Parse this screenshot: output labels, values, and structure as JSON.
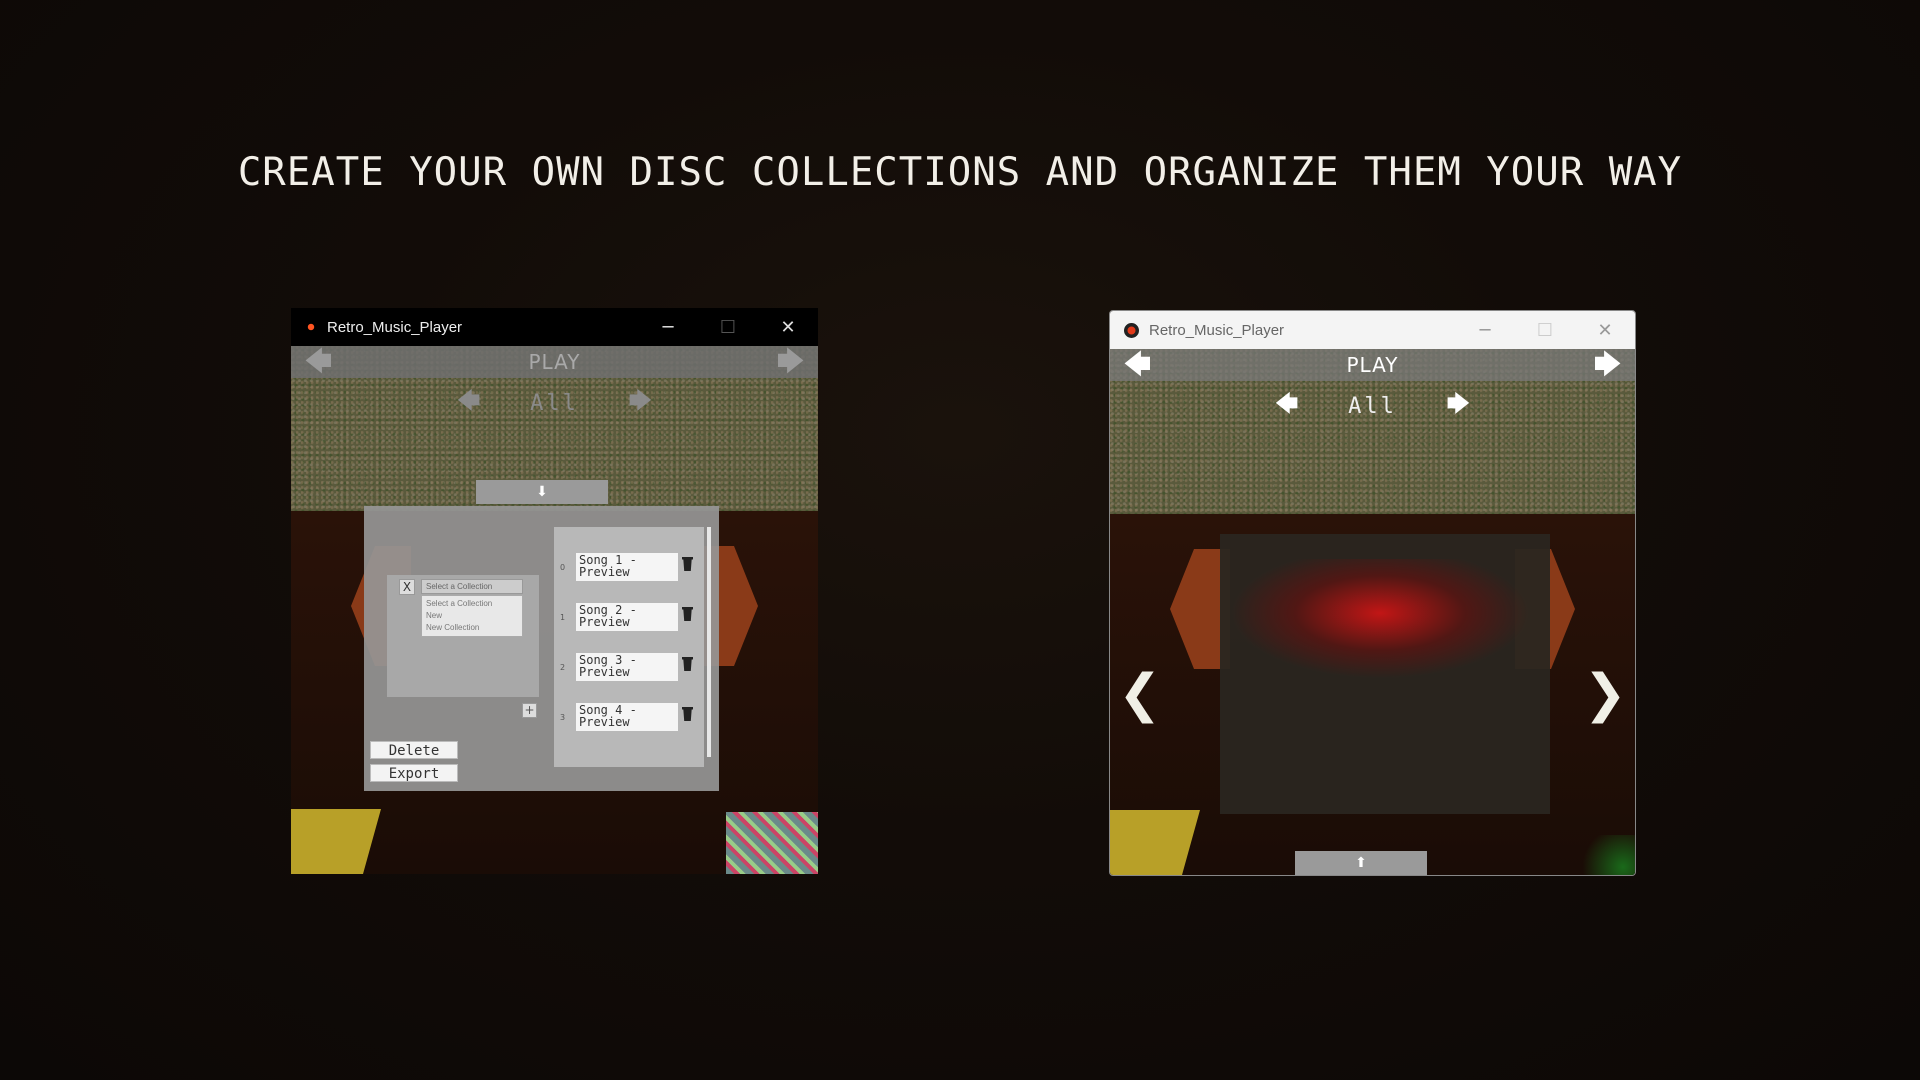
{
  "headline": "CREATE YOUR OWN DISC COLLECTIONS AND ORGANIZE THEM YOUR WAY",
  "left_window": {
    "title": "Retro_Music_Player",
    "nav": {
      "prev": "🡄",
      "title": "PLAY",
      "next": "🡆"
    },
    "subnav": {
      "prev": "🡄",
      "label": "All",
      "next": "🡆"
    },
    "panel_toggle": "⬇",
    "collections": {
      "close": "X",
      "select_value": "Select a Collection",
      "options": [
        "Select a Collection",
        "New",
        "New Collection"
      ],
      "add": "+",
      "delete_label": "Delete",
      "export_label": "Export"
    },
    "songs": [
      {
        "index": "0",
        "label": "Song 1 -\nPreview"
      },
      {
        "index": "1",
        "label": "Song 2 -\nPreview"
      },
      {
        "index": "2",
        "label": "Song 3 -\nPreview"
      },
      {
        "index": "3",
        "label": "Song 4 -\nPreview"
      }
    ]
  },
  "right_window": {
    "title": "Retro_Music_Player",
    "nav": {
      "prev": "🡄",
      "title": "PLAY",
      "next": "🡆"
    },
    "subnav": {
      "prev": "🡄",
      "label": "All",
      "next": "🡆"
    },
    "disc_prev": "❮",
    "disc_next": "❯",
    "panel_toggle": "⬆"
  },
  "window_controls": {
    "minimize": "─",
    "maximize": "☐",
    "close": "✕"
  },
  "colors": {
    "accent_red": "#e02020",
    "cabinet": "#8a3a18",
    "text_light": "#f2efe8"
  }
}
